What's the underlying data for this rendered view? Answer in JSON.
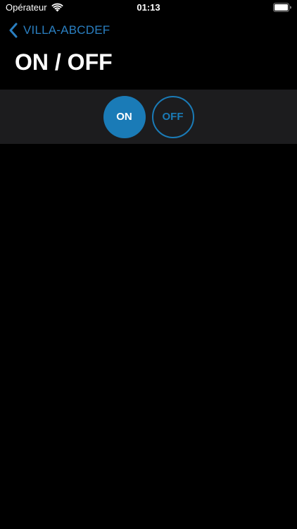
{
  "status_bar": {
    "carrier": "Opérateur",
    "time": "01:13",
    "wifi_icon": "wifi-icon",
    "battery_icon": "battery-icon"
  },
  "nav": {
    "back_label": "VILLA-ABCDEF",
    "back_icon": "chevron-left-icon"
  },
  "page": {
    "title": "ON / OFF"
  },
  "controls": {
    "on_label": "ON",
    "off_label": "OFF",
    "selected": "ON"
  },
  "colors": {
    "accent": "#1a7bb7",
    "background": "#000000",
    "strip": "#1c1c1e"
  }
}
